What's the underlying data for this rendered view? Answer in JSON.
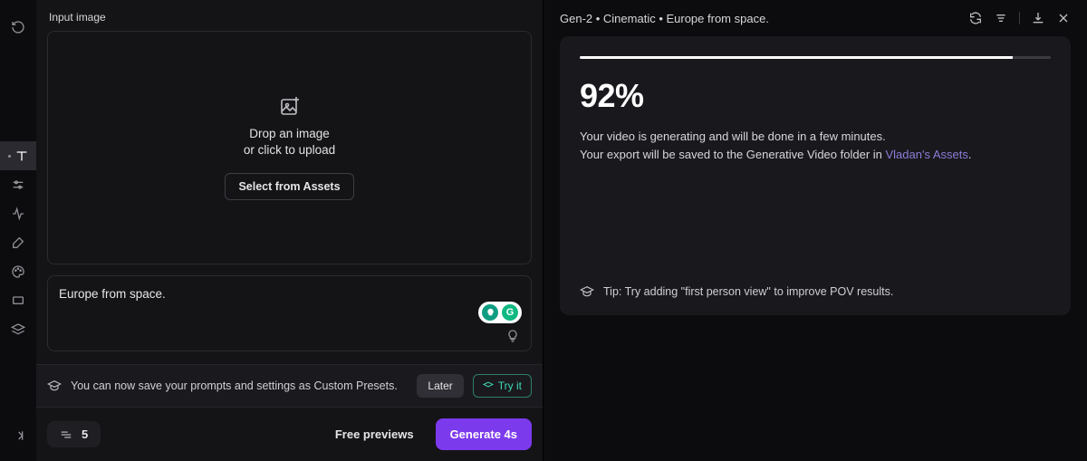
{
  "left": {
    "header": "Input image",
    "dropzone": {
      "line1": "Drop an image",
      "line2": "or click to upload",
      "button": "Select from Assets"
    },
    "prompt": "Europe from space.",
    "notice": {
      "text": "You can now save your prompts and settings as Custom Presets.",
      "later": "Later",
      "tryit": "Try it"
    },
    "actions": {
      "seed_value": "5",
      "free_previews": "Free previews",
      "generate": "Generate 4s"
    }
  },
  "right": {
    "title": "Gen-2 • Cinematic • Europe from space.",
    "progress": {
      "percent_label": "92%",
      "percent_value": 92,
      "status_line1": "Your video is generating and will be done in a few minutes.",
      "status_line2_prefix": "Your export will be saved to the Generative Video folder in ",
      "status_line2_link": "Vladan's Assets",
      "status_line2_suffix": "."
    },
    "tip": "Tip: Try adding \"first person view\" to improve POV results."
  },
  "sidebar": {
    "items": [
      "text",
      "sliders",
      "motion",
      "brush",
      "palette",
      "display",
      "layers"
    ]
  }
}
